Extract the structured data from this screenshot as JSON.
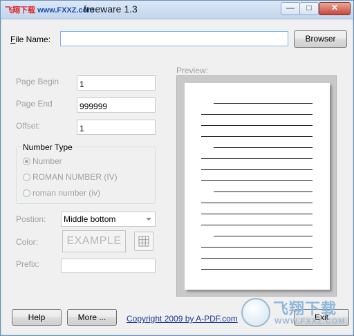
{
  "window": {
    "watermark_prefix": "飞翔下载",
    "watermark_url": "www.FXXZ.com",
    "title": "freeware 1.3",
    "min_glyph": "—",
    "max_glyph": "□",
    "close_glyph": "✕"
  },
  "file": {
    "label_hot": "F",
    "label_rest": "ile Name:",
    "value": "",
    "browse_label": "Browser"
  },
  "fields": {
    "page_begin_label": "Page Begin",
    "page_begin_value": "1",
    "page_end_label": "Page End",
    "page_end_value": "999999",
    "offset_label": "Offset:",
    "offset_value": "1"
  },
  "number_type": {
    "title": "Number Type",
    "options": [
      "Number",
      "ROMAN NUMBER (IV)",
      "roman number (iv)"
    ],
    "selected": "Number"
  },
  "position": {
    "label": "Postion:",
    "value": "Middle bottom"
  },
  "color": {
    "label": "Color:",
    "example": "EXAMPLE",
    "picker_icon": "grid-icon"
  },
  "prefix": {
    "label": "Prefix:",
    "value": ""
  },
  "preview": {
    "label": "Preview:"
  },
  "bottom": {
    "help_label": "Help",
    "more_label": "More ...",
    "copyright": "Copyright 2009 by A-PDF.com",
    "exit_label": "Exit"
  },
  "logo": {
    "text": "飞翔下载",
    "url": "WWW.FXXZ.COM"
  },
  "colors": {
    "title_bar": "#c3d6ee",
    "link": "#1a3a9c",
    "disabled_text": "#a0a0a0",
    "close_button": "#c9473a"
  }
}
